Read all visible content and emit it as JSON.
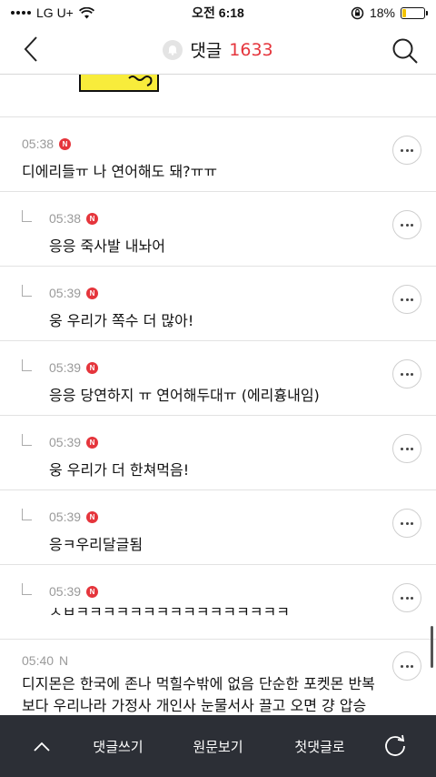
{
  "status_bar": {
    "carrier": "LG U+",
    "time": "오전 6:18",
    "battery_percent": "18%",
    "battery_level": 0.18
  },
  "header": {
    "title": "댓글",
    "count": "1633",
    "icons": {
      "back": "chevron-left-icon",
      "bell": "bell-icon",
      "search": "search-icon"
    }
  },
  "comments": [
    {
      "type": "top",
      "time": "05:38",
      "badge": "N",
      "text": "디에리들ㅠ 나 연어해도 돼?ㅠㅠ"
    },
    {
      "type": "reply",
      "time": "05:38",
      "badge": "N",
      "text": "응응 죽사발 내놔어"
    },
    {
      "type": "reply",
      "time": "05:39",
      "badge": "N",
      "text": "웅 우리가 쪽수 더 많아!"
    },
    {
      "type": "reply",
      "time": "05:39",
      "badge": "N",
      "text": "응응 당연하지 ㅠ 연어해두대ㅠ (에리흉내임)"
    },
    {
      "type": "reply",
      "time": "05:39",
      "badge": "N",
      "text": "웅 우리가 더 한쳐먹음!"
    },
    {
      "type": "reply",
      "time": "05:39",
      "badge": "N",
      "text": "응ㅋ우리달글됨"
    },
    {
      "type": "reply",
      "time": "05:39",
      "badge": "N",
      "text": "ㅅㅂㅋㅋㅋㅋㅋㅋㅋㅋㅋㅋㅋㅋㅋㅋㅋㅋ"
    }
  ],
  "last_comment": {
    "time": "05:40",
    "badge": "N",
    "text": "디지몬은 한국에 존나 먹힐수밖에 없음 단순한 포켓몬 반복보다 우리나라 가정사 개인사 눈물서사 끌고 오면 걍 압승"
  },
  "bottom_bar": {
    "write": "댓글쓰기",
    "original": "원문보기",
    "first": "첫댓글로",
    "icons": {
      "up": "chevron-up-icon",
      "refresh": "refresh-icon"
    },
    "background": "#2c2f36"
  },
  "colors": {
    "accent": "#e5353c",
    "badge": "#e5353c",
    "meta_text": "#9a9a9a"
  }
}
